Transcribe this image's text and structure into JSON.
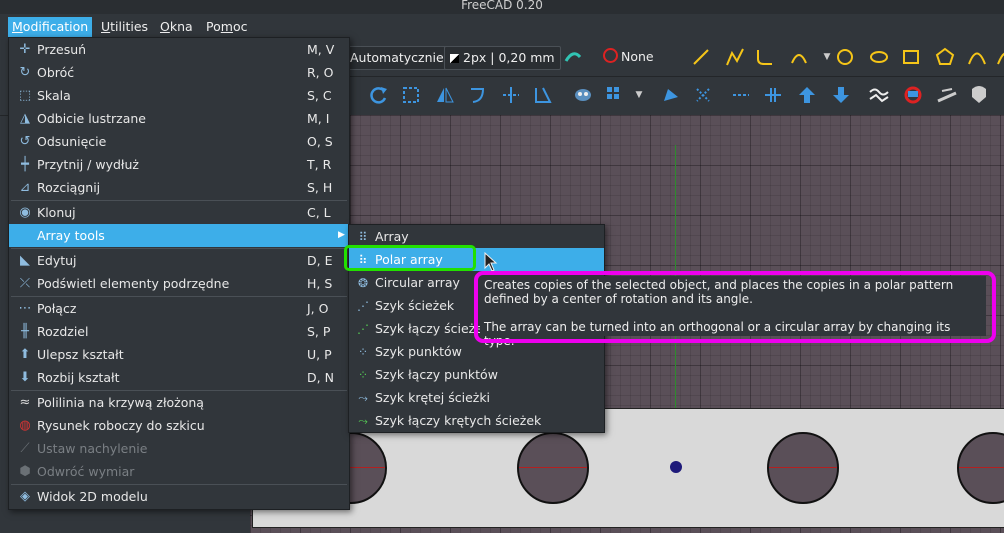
{
  "window": {
    "title": "FreeCAD 0.20"
  },
  "menubar": {
    "items": [
      {
        "label": "Modification",
        "mnemonic": "M",
        "rest": "odification"
      },
      {
        "label": "Utilities",
        "mnemonic": "U",
        "rest": "tilities"
      },
      {
        "label": "Okna",
        "mnemonic": "O",
        "rest": "kna"
      },
      {
        "label": "Pomoc",
        "pre": "Po",
        "mnemonic": "m",
        "rest": "oc"
      }
    ]
  },
  "toolbar": {
    "construction_mode": "Automatycznie",
    "line_style": "2px | 0,20 mm",
    "color_none": "None"
  },
  "menu": {
    "items": [
      {
        "label": "Przesuń",
        "shortcut": "M, V",
        "icon": "move-icon"
      },
      {
        "label": "Obróć",
        "shortcut": "R, O",
        "icon": "rotate-icon"
      },
      {
        "label": "Skala",
        "shortcut": "S, C",
        "icon": "scale-icon"
      },
      {
        "label": "Odbicie lustrzane",
        "shortcut": "M, I",
        "icon": "mirror-icon"
      },
      {
        "label": "Odsunięcie",
        "shortcut": "O, S",
        "icon": "offset-icon"
      },
      {
        "label": "Przytnij / wydłuż",
        "shortcut": "T, R",
        "icon": "trimex-icon"
      },
      {
        "label": "Rozciągnij",
        "shortcut": "S, H",
        "icon": "stretch-icon"
      },
      {
        "label": "Klonuj",
        "shortcut": "C, L",
        "icon": "clone-icon"
      },
      {
        "label": "Array tools",
        "shortcut": "",
        "icon": ""
      },
      {
        "label": "Edytuj",
        "shortcut": "D, E",
        "icon": "edit-icon"
      },
      {
        "label": "Podświetl elementy podrzędne",
        "shortcut": "H, S",
        "icon": "subelement-icon"
      },
      {
        "label": "Połącz",
        "shortcut": "J, O",
        "icon": "join-icon"
      },
      {
        "label": "Rozdziel",
        "shortcut": "S, P",
        "icon": "split-icon"
      },
      {
        "label": "Ulepsz kształt",
        "shortcut": "U, P",
        "icon": "upgrade-icon"
      },
      {
        "label": "Rozbij kształt",
        "shortcut": "D, N",
        "icon": "downgrade-icon"
      },
      {
        "label": "Polilinia na krzywą złożoną",
        "shortcut": "",
        "icon": "wire-to-bspline-icon"
      },
      {
        "label": "Rysunek roboczy do szkicu",
        "shortcut": "",
        "icon": "draft-to-sketch-icon"
      },
      {
        "label": "Ustaw nachylenie",
        "shortcut": "",
        "icon": "slope-icon"
      },
      {
        "label": "Odwróć wymiar",
        "shortcut": "",
        "icon": "flip-dimension-icon"
      },
      {
        "label": "Widok 2D modelu",
        "shortcut": "",
        "icon": "shape2dview-icon"
      }
    ]
  },
  "submenu": {
    "items": [
      {
        "label": "Array",
        "icon": "ortho-array-icon"
      },
      {
        "label": "Polar array",
        "icon": "polar-array-icon"
      },
      {
        "label": "Circular array",
        "icon": "circular-array-icon"
      },
      {
        "label": "Szyk ścieżek",
        "icon": "path-array-icon"
      },
      {
        "label": "Szyk łączy ścieże",
        "icon": "path-link-array-icon"
      },
      {
        "label": "Szyk punktów",
        "icon": "point-array-icon"
      },
      {
        "label": "Szyk łączy punktów",
        "icon": "point-link-array-icon"
      },
      {
        "label": "Szyk krętej ścieżki",
        "icon": "path-twisted-array-icon"
      },
      {
        "label": "Szyk łączy krętych ścieżek",
        "icon": "path-twisted-link-array-icon"
      }
    ]
  },
  "tooltip": {
    "line1": "Creates copies of the selected object, and places the copies in a polar pattern",
    "line2": "defined by a center of rotation and its angle.",
    "line3": "The array can be turned into an orthogonal or a circular array by changing its type."
  },
  "colors": {
    "accent": "#3daee9",
    "green_highlight": "#22e000",
    "magenta_highlight": "#ee00ee"
  }
}
